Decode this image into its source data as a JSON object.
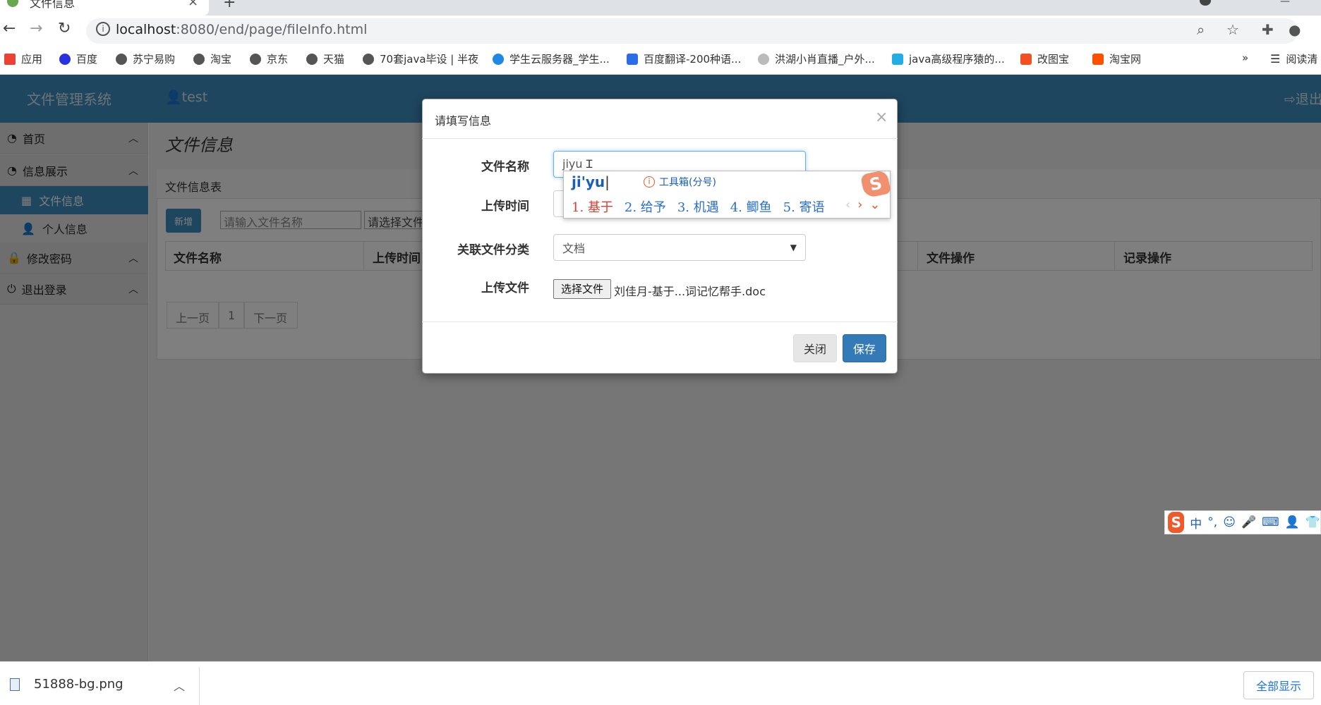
{
  "browser": {
    "tab_title": "文件信息",
    "url_host": "localhost",
    "url_path": ":8080/end/page/fileInfo.html",
    "bookmarks": [
      {
        "label": "应用",
        "icon": "apps-grid-icon"
      },
      {
        "label": "百度",
        "icon": "baidu-paw-icon"
      },
      {
        "label": "苏宁易购",
        "icon": "globe-icon"
      },
      {
        "label": "淘宝",
        "icon": "globe-icon"
      },
      {
        "label": "京东",
        "icon": "globe-icon"
      },
      {
        "label": "天猫",
        "icon": "globe-icon"
      },
      {
        "label": "70套java毕设 | 半夜",
        "icon": "globe-icon"
      },
      {
        "label": "学生云服务器_学生...",
        "icon": "cloud-icon"
      },
      {
        "label": "百度翻译-200种语...",
        "icon": "translate-icon"
      },
      {
        "label": "洪湖小肖直播_户外...",
        "icon": "live-icon"
      },
      {
        "label": "java高级程序猿的...",
        "icon": "bilibili-icon"
      },
      {
        "label": "改图宝",
        "icon": "image-icon"
      },
      {
        "label": "淘宝网",
        "icon": "taobao-icon"
      }
    ],
    "overflow": "»",
    "reading_list": "阅读清"
  },
  "app": {
    "title": "文件管理系统",
    "user": "test",
    "logout": "退出"
  },
  "sidebar": {
    "items": [
      {
        "label": "首页"
      },
      {
        "label": "信息展示"
      },
      {
        "label": "修改密码"
      },
      {
        "label": "退出登录"
      }
    ],
    "subitems": [
      {
        "label": "文件信息",
        "active": true
      },
      {
        "label": "个人信息",
        "active": false
      }
    ]
  },
  "main": {
    "page_title": "文件信息",
    "panel_title": "文件信息表",
    "new_button": "新增",
    "search_placeholder": "请输入文件名称",
    "select_placeholder": "请选择文件",
    "columns": [
      "文件名称",
      "上传时间",
      "文件操作",
      "记录操作"
    ],
    "pager": {
      "prev": "上一页",
      "page": "1",
      "next": "下一页"
    }
  },
  "modal": {
    "title": "请填写信息",
    "close_symbol": "×",
    "fields": {
      "file_name_label": "文件名称",
      "file_name_value": "jiyu",
      "upload_time_label": "上传时间",
      "category_label": "关联文件分类",
      "category_value": "文档",
      "upload_file_label": "上传文件",
      "choose_file_button": "选择文件",
      "chosen_file_name": "刘佳月-基于...词记忆帮手.doc"
    },
    "buttons": {
      "close": "关闭",
      "save": "保存"
    }
  },
  "ime": {
    "composition": "ji'yu",
    "toolbox": "工具箱(分号)",
    "candidates": [
      "1. 基于",
      "2. 给予",
      "3. 机遇",
      "4. 鲫鱼",
      "5. 寄语"
    ],
    "logo": "S",
    "status_bar": [
      "中",
      "°,",
      "☺",
      "🎤",
      "⌨",
      "👤",
      "👕"
    ]
  },
  "downloads": {
    "file": "51888-bg.png",
    "show_all": "全部显示"
  },
  "colors": {
    "header_blue": "#3c8dbc",
    "save_blue": "#337ab7",
    "ime_orange": "#ee5a2c"
  }
}
